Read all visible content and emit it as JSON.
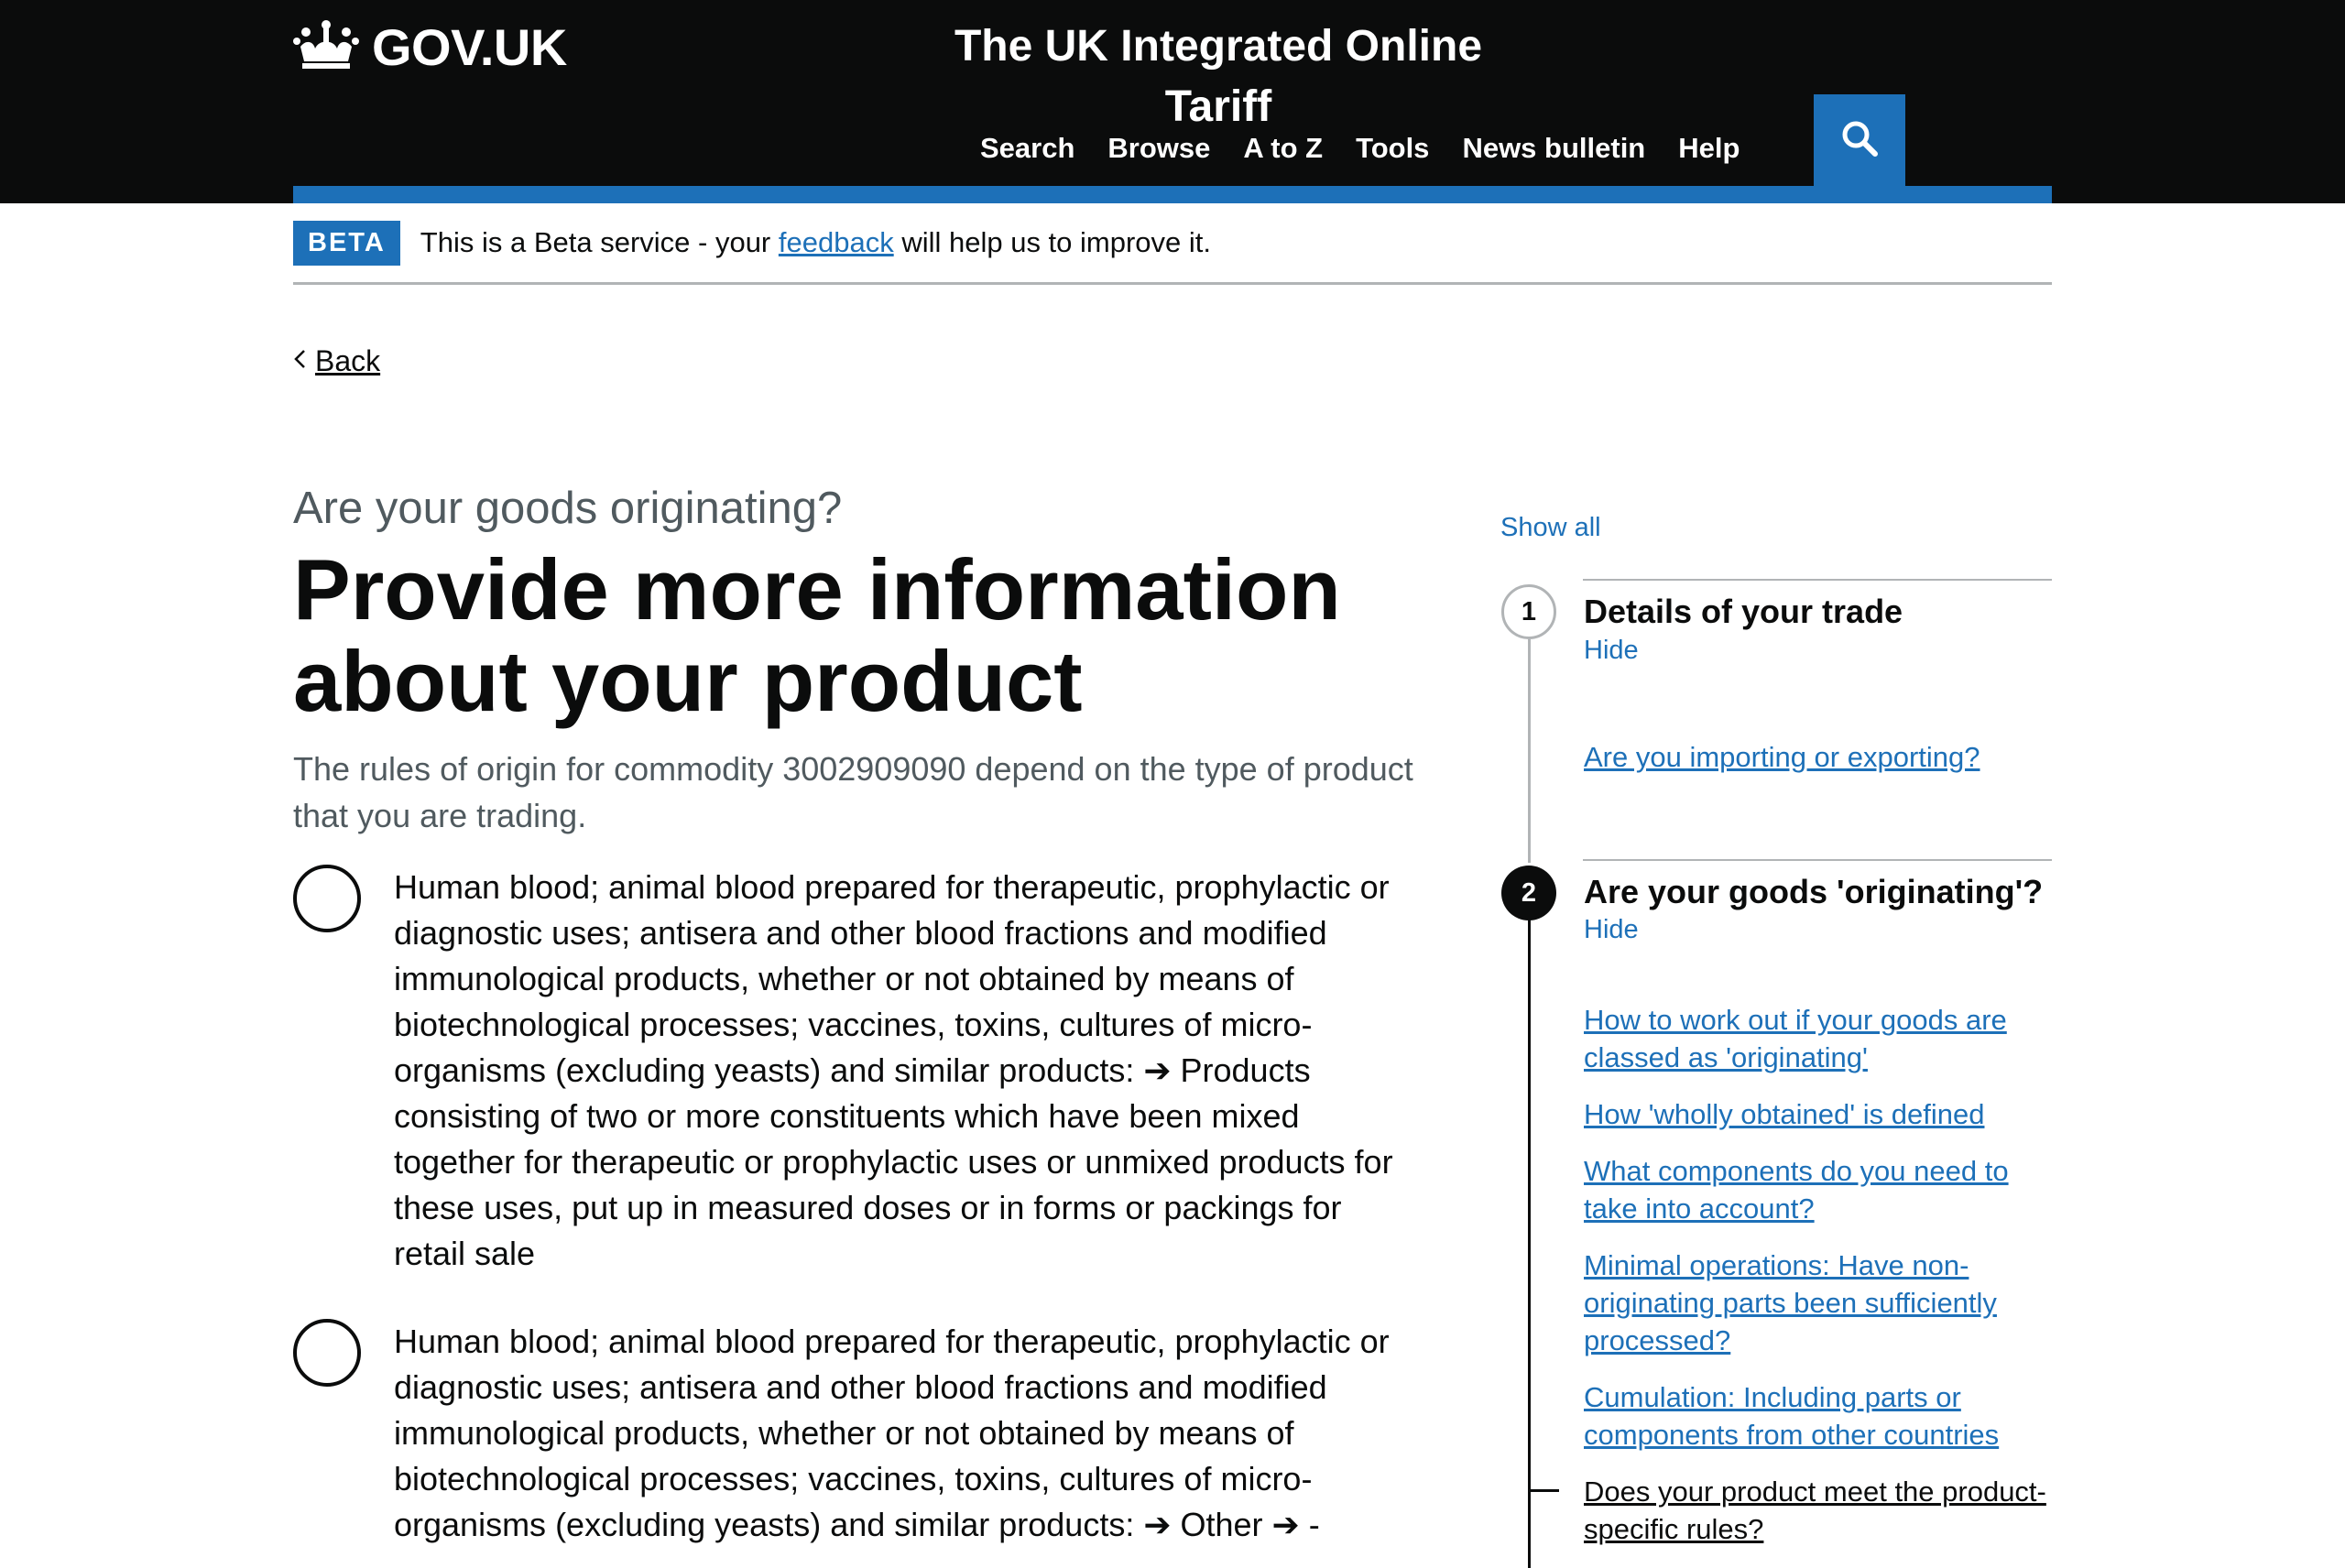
{
  "header": {
    "logo_text": "GOV.UK",
    "service_title": "The UK Integrated Online Tariff",
    "nav": [
      "Search",
      "Browse",
      "A to Z",
      "Tools",
      "News bulletin",
      "Help"
    ],
    "search_icon": "magnifying-glass"
  },
  "beta": {
    "tag": "BETA",
    "text_before": "This is a Beta service - your ",
    "link": "feedback",
    "text_after": " will help us to improve it."
  },
  "back": {
    "label": "Back"
  },
  "main": {
    "caption": "Are your goods originating?",
    "title": "Provide more information about your product",
    "lede": "The rules of origin for commodity 3002909090 depend on the type of product that you are trading.",
    "options": [
      "Human blood; animal blood prepared for therapeutic, prophylactic or diagnostic uses; antisera and other blood fractions and modified immunological products, whether or not obtained by means of biotechnological processes; vaccines, toxins, cultures of micro-organisms (excluding yeasts) and similar products: ➔ Products consisting of two or more constituents which have been mixed together for therapeutic or prophylactic uses or unmixed products for these uses, put up in measured doses or in forms or packings for retail sale",
      "Human blood; animal blood prepared for therapeutic, prophylactic or diagnostic uses; antisera and other blood fractions and modified immunological products, whether or not obtained by means of biotechnological processes; vaccines, toxins, cultures of micro-organisms (excluding yeasts) and similar products: ➔ Other ➔ -"
    ]
  },
  "sidebar": {
    "show_all": "Show all",
    "steps": [
      {
        "number": "1",
        "title": "Details of your trade",
        "toggle": "Hide",
        "links": [
          "Are you importing or exporting?"
        ]
      },
      {
        "number": "2",
        "title": "Are your goods 'originating'?",
        "toggle": "Hide",
        "links": [
          "How to work out if your goods are classed as 'originating'",
          "How 'wholly obtained' is defined",
          "What components do you need to take into account?",
          "Minimal operations: Have non-originating parts been sufficiently processed?",
          "Cumulation: Including parts or components from other countries",
          "Does your product meet the product-specific rules?"
        ]
      }
    ]
  },
  "colors": {
    "header_bg": "#0b0c0c",
    "brand_blue": "#1d70b8",
    "text": "#0b0c0c",
    "secondary_text": "#505a5f",
    "border": "#b1b4b6"
  }
}
